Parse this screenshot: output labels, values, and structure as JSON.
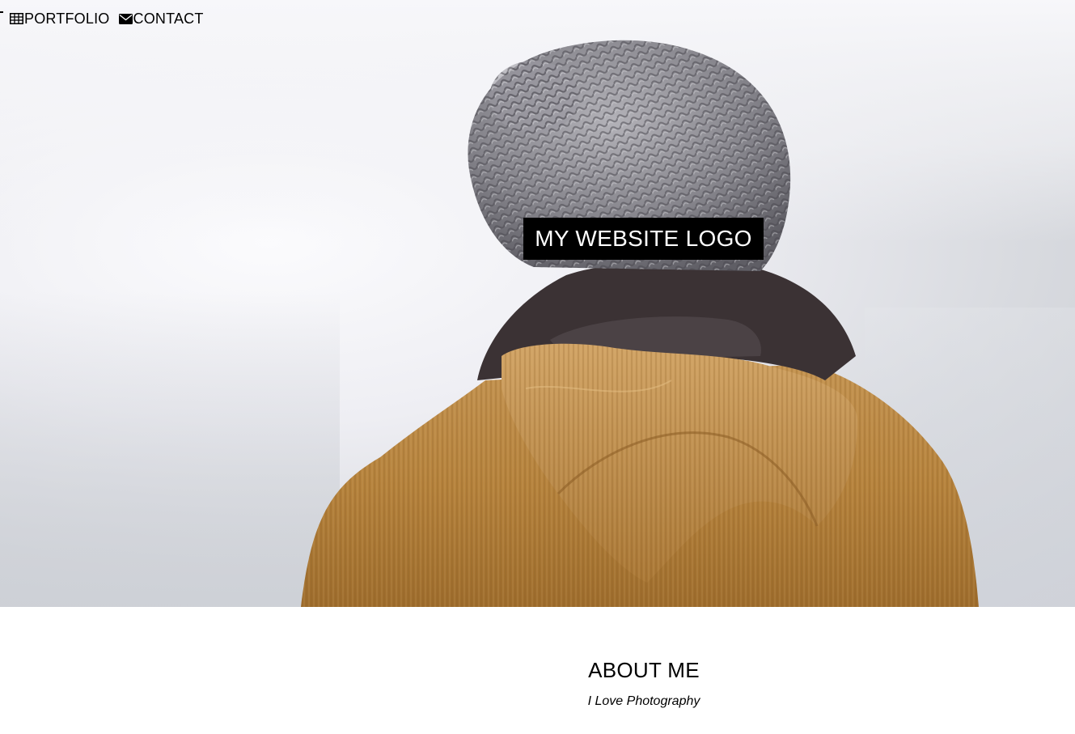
{
  "nav": {
    "items": [
      {
        "label": "PORTFOLIO",
        "icon": "th-grid-icon"
      },
      {
        "label": "CONTACT",
        "icon": "envelope-icon"
      }
    ]
  },
  "hero": {
    "logo_text": "MY WEBSITE LOGO",
    "image_subject": "person-with-knit-beanie-and-corduroy-jacket"
  },
  "about": {
    "title": "ABOUT ME",
    "subtitle": "I Love Photography"
  },
  "colors": {
    "logo_background": "#000000",
    "logo_text": "#ffffff",
    "jacket": "#b8843c",
    "beanie": "#8a8a90",
    "collar": "#3a3133"
  }
}
